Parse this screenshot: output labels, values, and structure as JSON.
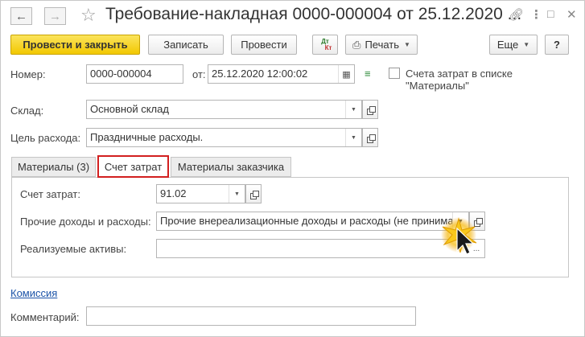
{
  "window": {
    "title": "Требование-накладная 0000-000004 от 25.12.2020 ...",
    "back_icon": "arrow-left-icon",
    "forward_icon": "arrow-right-icon",
    "favorite_icon": "star-icon",
    "link_icon": "link-icon",
    "menu_icon": "more-vert-icon",
    "maximize_icon": "maximize-icon",
    "close_icon": "close-icon"
  },
  "toolbar": {
    "post_close_label": "Провести и закрыть",
    "save_label": "Записать",
    "post_label": "Провести",
    "dt_kt_label_dt": "Дт",
    "dt_kt_label_kt": "Кт",
    "print_label": "Печать",
    "more_label": "Еще",
    "help_label": "?"
  },
  "header": {
    "number_label": "Номер:",
    "number_value": "0000-000004",
    "date_label": "от:",
    "date_value": "25.12.2020 12:00:02",
    "costs_in_list_label_line1": "Счета затрат в списке",
    "costs_in_list_label_line2": "\"Материалы\"",
    "costs_in_list_checked": false
  },
  "warehouse": {
    "label": "Склад:",
    "value": "Основной склад"
  },
  "purpose": {
    "label": "Цель расхода:",
    "value": "Праздничные расходы."
  },
  "tabs": [
    {
      "label": "Материалы (3)",
      "active": false
    },
    {
      "label": "Счет затрат",
      "active": true
    },
    {
      "label": "Материалы заказчика",
      "active": false
    }
  ],
  "cost_tab": {
    "account_label": "Счет затрат:",
    "account_value": "91.02",
    "other_label": "Прочие доходы и расходы:",
    "other_value": "Прочие внереализационные доходы и расходы (не принима",
    "assets_label": "Реализуемые активы:",
    "assets_value": ""
  },
  "footer": {
    "commission_link": "Комиссия",
    "comment_label": "Комментарий:",
    "comment_value": ""
  },
  "colors": {
    "primary_button": "#f2c800",
    "active_tab_border": "#d21f1f",
    "link": "#1b53a8"
  }
}
